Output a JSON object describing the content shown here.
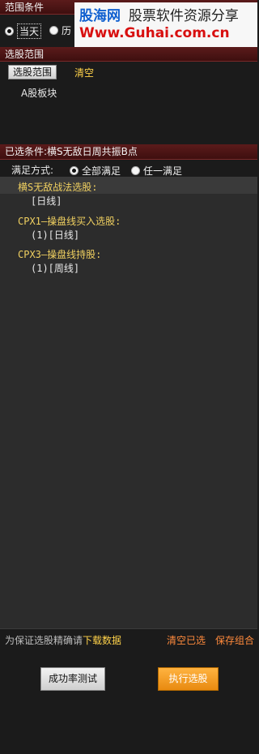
{
  "range_conditions": {
    "header": "范围条件",
    "radio_current_label": "当天",
    "radio_history_label": "历"
  },
  "watermark": {
    "brand": "股海网",
    "tagline": "股票软件资源分享",
    "url": "Www.Guhai.com.cn",
    "brand_color": "#1060d0",
    "url_color": "#d81010"
  },
  "stock_range": {
    "header": "选股范围",
    "select_button": "选股范围",
    "clear_link": "清空",
    "selected_item": "A股板块"
  },
  "selected_conditions": {
    "header": "已选条件:横S无敌日周共振B点",
    "match_mode_label": "满足方式:",
    "match_all_label": "全部满足",
    "match_any_label": "任一满足",
    "items": [
      {
        "title": "横S无敌战法选股:",
        "sub": "[日线]"
      },
      {
        "title": "CPX1—操盘线买入选股:",
        "sub": "(1)[日线]"
      },
      {
        "title": "CPX3—操盘线持股:",
        "sub": "(1)[周线]"
      }
    ]
  },
  "footer": {
    "hint_prefix": "为保证选股精确请",
    "download_link": "下载数据",
    "clear_selected_link": "清空已选",
    "save_combo_link": "保存组合",
    "success_test_button": "成功率测试",
    "execute_button": "执行选股",
    "accent_orange": "#f0961a"
  }
}
